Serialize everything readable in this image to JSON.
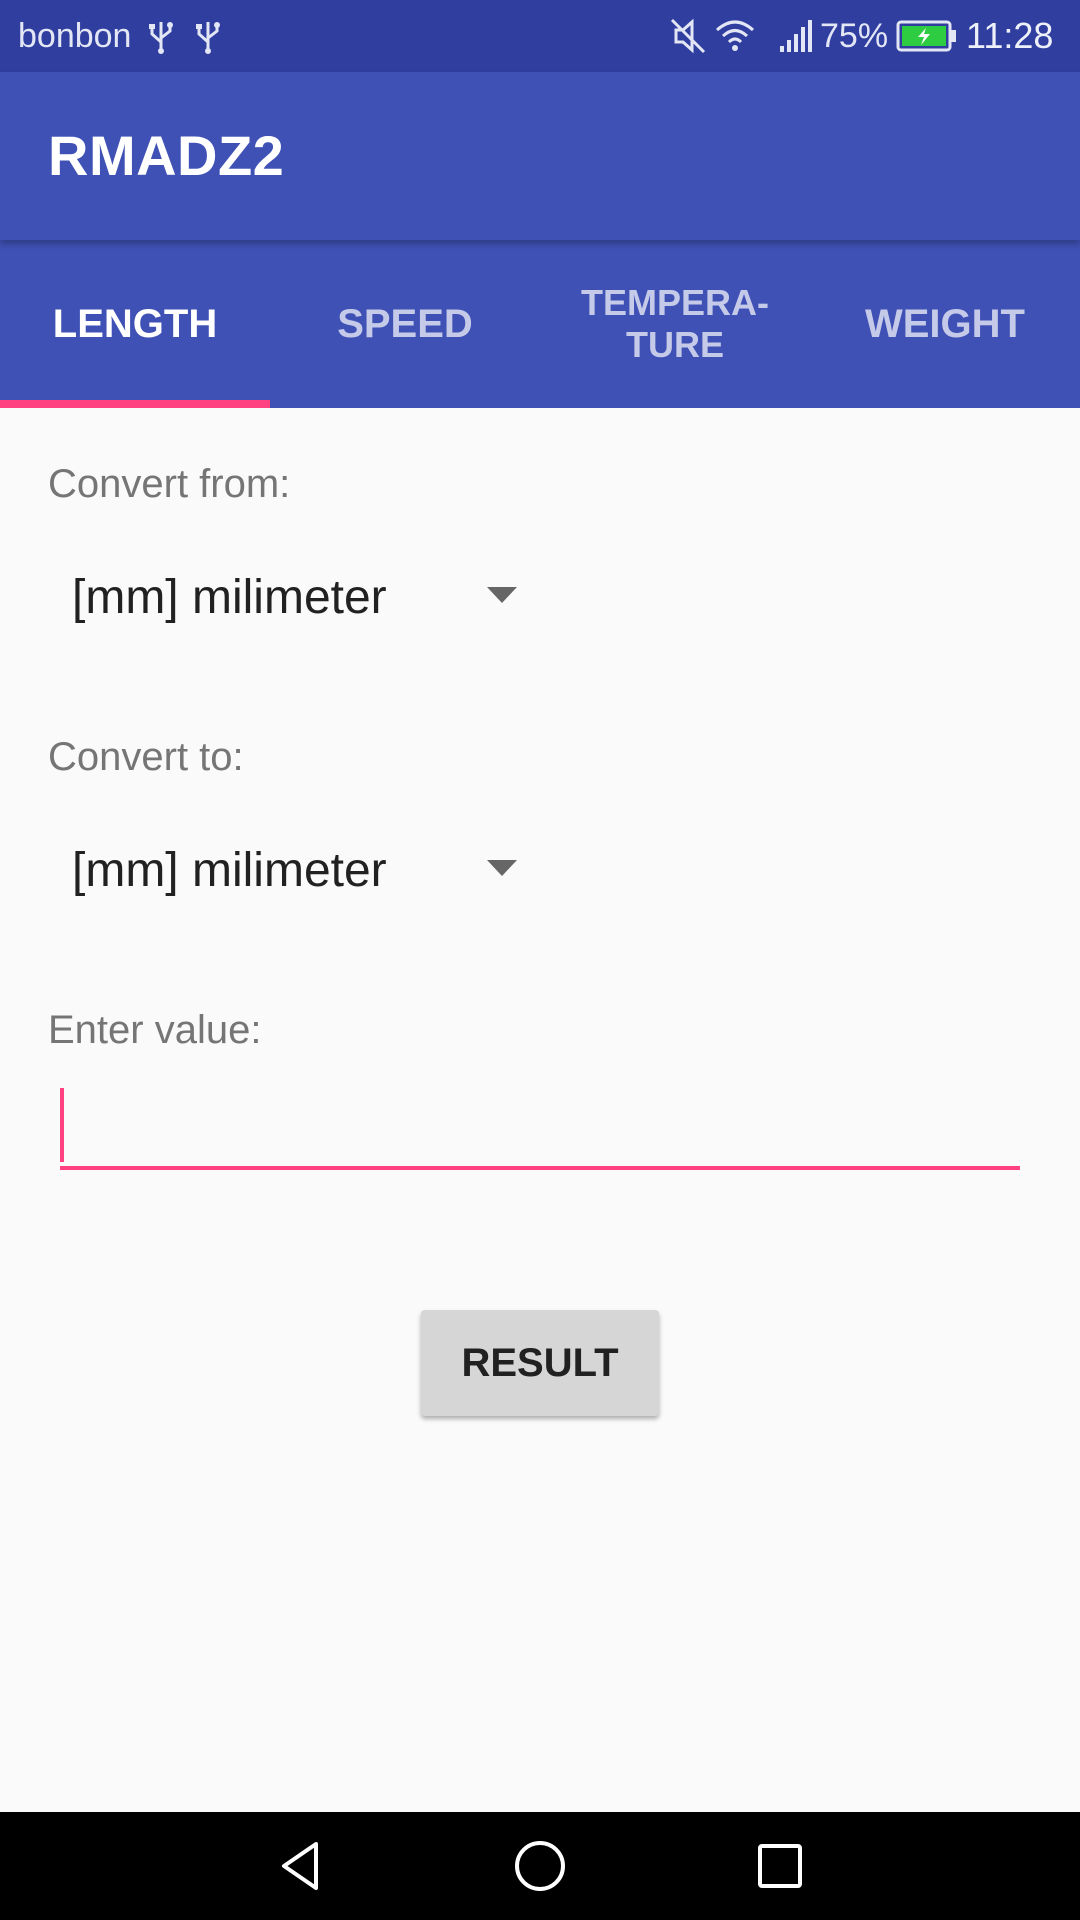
{
  "status_bar": {
    "carrier": "bonbon",
    "battery_percent": "75%",
    "time": "11:28",
    "icons": [
      "usb-icon",
      "usb-icon",
      "mute-icon",
      "wifi-icon",
      "signal-icon",
      "battery-charging-icon"
    ]
  },
  "app_bar": {
    "title": "RMADZ2"
  },
  "tabs": [
    {
      "label": "LENGTH",
      "active": true
    },
    {
      "label": "SPEED",
      "active": false
    },
    {
      "label": "TEMPERA-\nTURE",
      "active": false
    },
    {
      "label": "WEIGHT",
      "active": false
    }
  ],
  "form": {
    "from_label": "Convert from:",
    "from_value": "[mm] milimeter",
    "to_label": "Convert to:",
    "to_value": "[mm] milimeter",
    "value_label": "Enter value:",
    "value_input": "",
    "result_button": "RESULT"
  },
  "colors": {
    "primary": "#3f51b5",
    "primary_dark": "#303f9f",
    "accent": "#ff4081"
  },
  "nav_bar": {
    "icons": [
      "back-icon",
      "home-icon",
      "recents-icon"
    ]
  }
}
